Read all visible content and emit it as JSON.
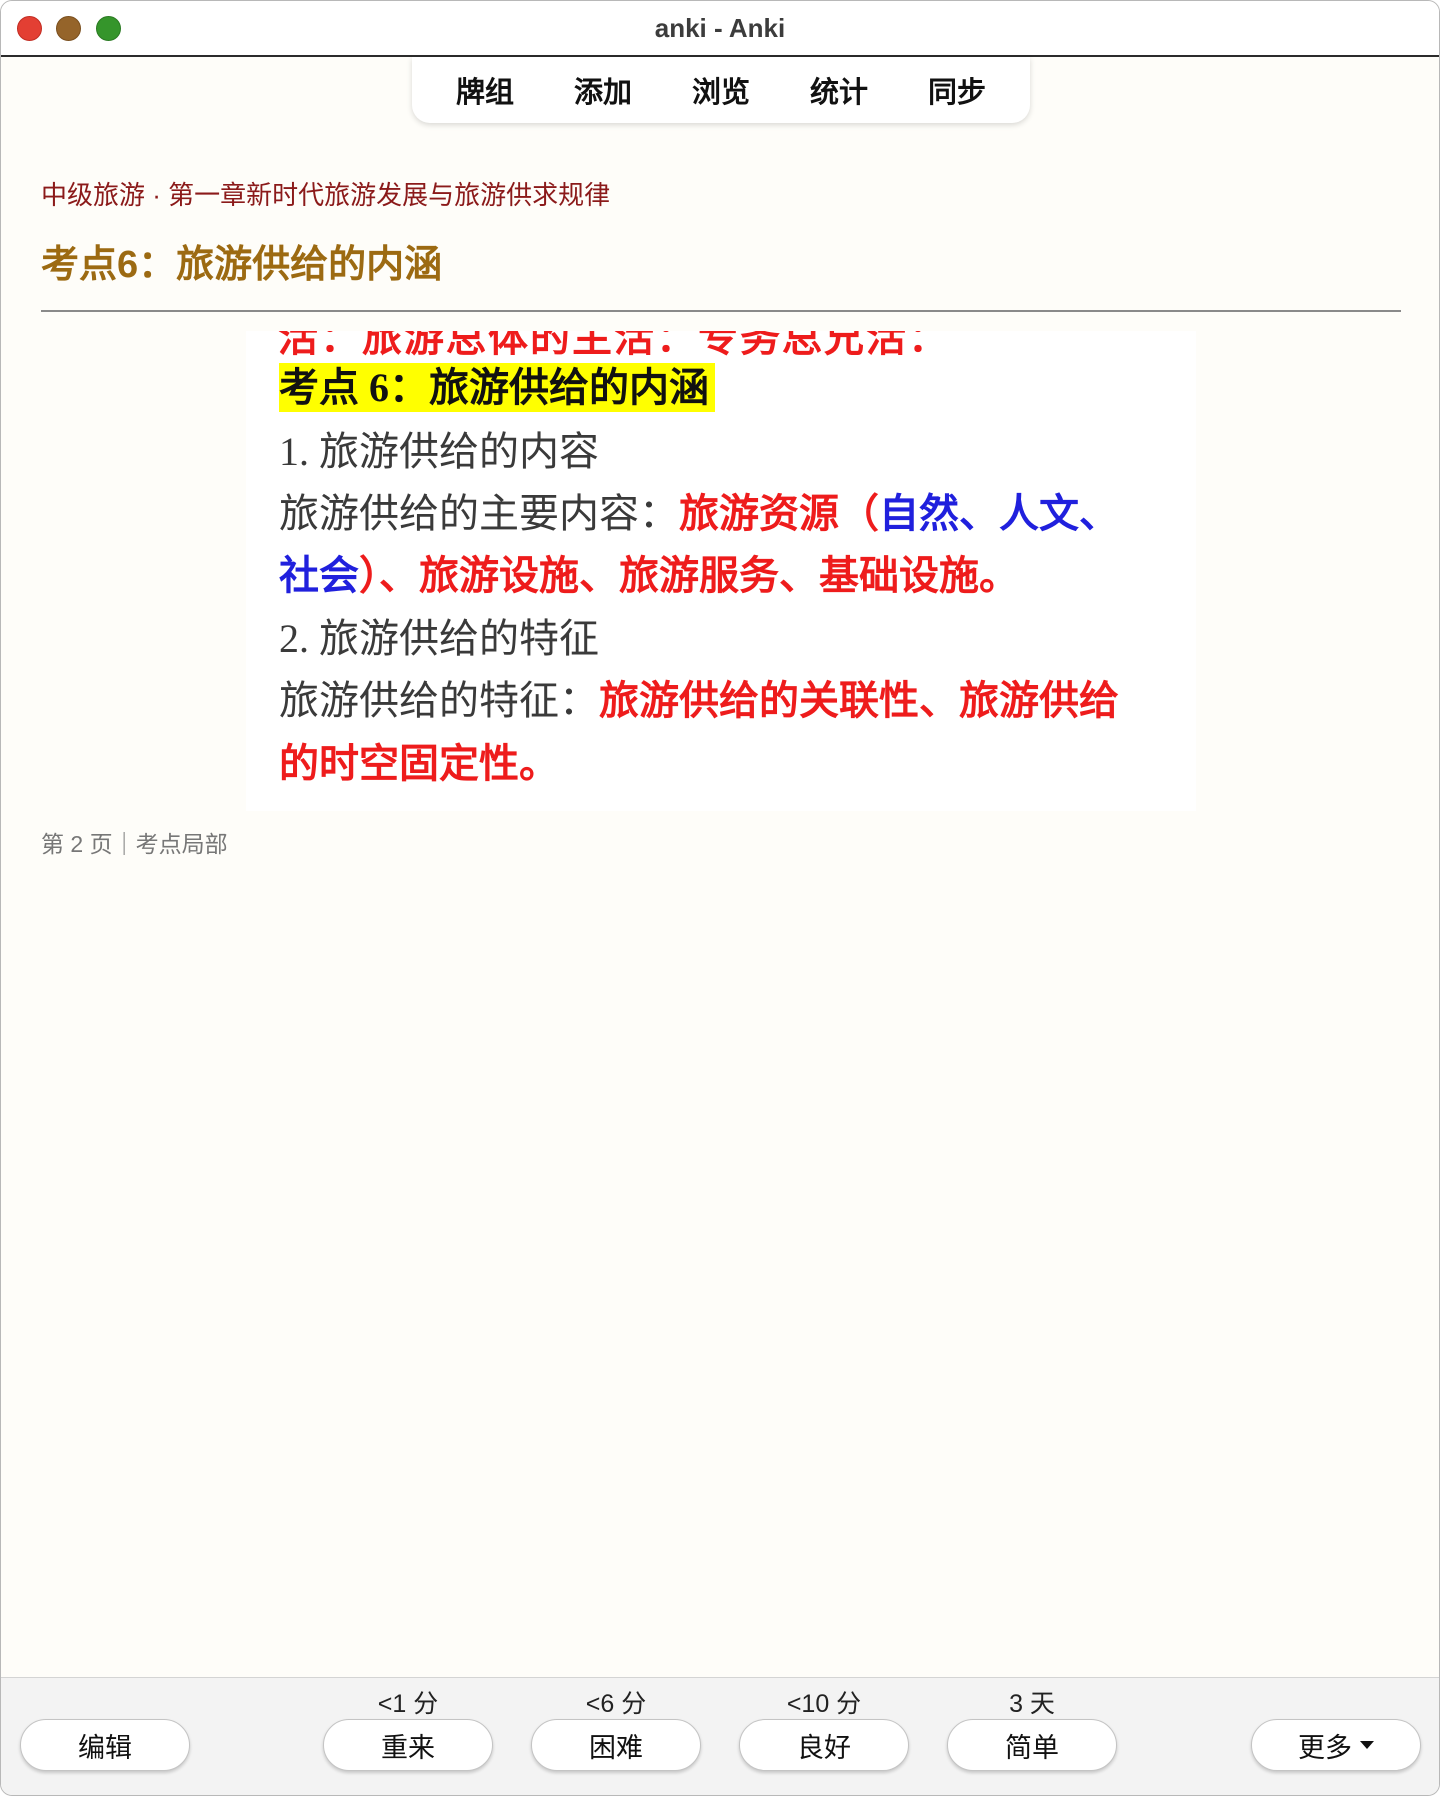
{
  "window": {
    "title": "anki - Anki"
  },
  "nav": {
    "items": [
      "牌组",
      "添加",
      "浏览",
      "统计",
      "同步"
    ]
  },
  "card": {
    "deck_path": "中级旅游 · 第一章新时代旅游发展与旅游供求规律",
    "heading": "考点6：旅游供给的内涵",
    "excerpt": {
      "cut_line": "活：旅游总体的主活：专务总兄活：",
      "highlight_title": "考点 6：旅游供给的内涵",
      "line1": "1. 旅游供给的内容",
      "line2_prefix": "旅游供给的主要内容：",
      "line2_red1": "旅游资源（",
      "line2_blue1": "自然、人文、",
      "line3_blue": "社会",
      "line3_red": "）、旅游设施、旅游服务、基础设施。",
      "line4": "2. 旅游供给的特征",
      "line5_prefix": "旅游供给的特征：",
      "line5_red": "旅游供给的关联性、旅游供给",
      "line6_red": "的时空固定性。"
    },
    "page_note": "第 2 页｜考点局部"
  },
  "answer_bar": {
    "edit_label": "编辑",
    "more_label": "更多",
    "buttons": [
      {
        "interval": "<1 分",
        "label": "重来"
      },
      {
        "interval": "<6 分",
        "label": "困难"
      },
      {
        "interval": "<10 分",
        "label": "良好"
      },
      {
        "interval": "3 天",
        "label": "简单"
      }
    ]
  },
  "colors": {
    "deck_path": "#8b1a1a",
    "heading": "#9c6a12",
    "emphasis_red": "#ee1c1c",
    "emphasis_blue": "#2020dd",
    "highlight": "#ffff00"
  }
}
